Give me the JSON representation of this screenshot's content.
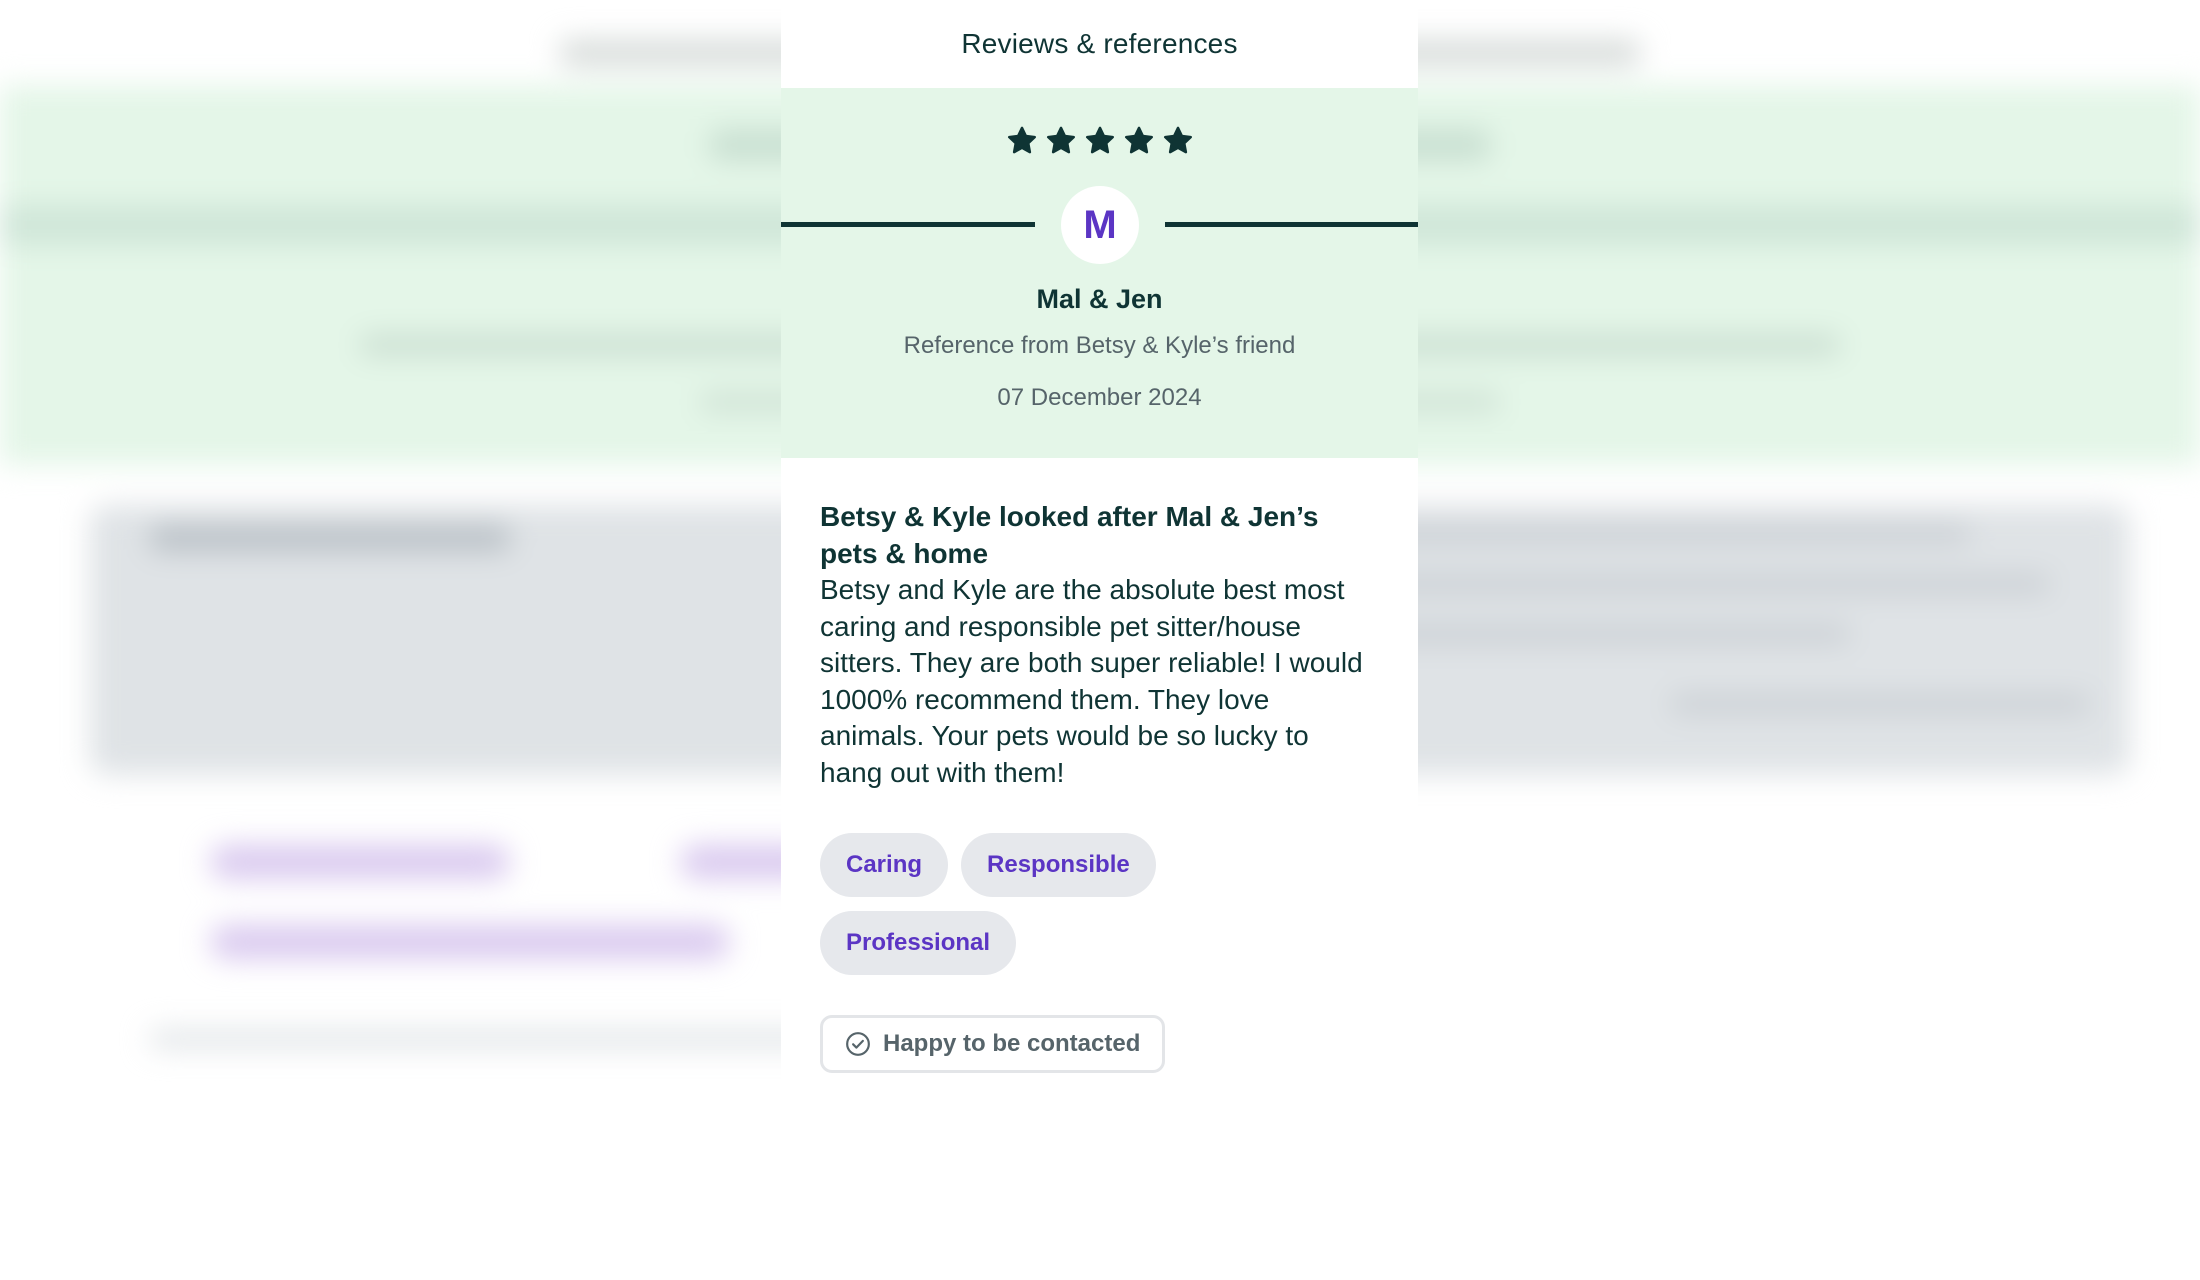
{
  "modal": {
    "title": "Reviews & references"
  },
  "review": {
    "rating": 5,
    "max_rating": 5,
    "avatar_initial": "M",
    "reviewer_name": "Mal & Jen",
    "reference_line": "Reference from Betsy & Kyle’s friend",
    "date": "07 December 2024",
    "title": "Betsy & Kyle looked after Mal & Jen’s pets & home",
    "text": "Betsy and Kyle are the absolute best most caring and responsible pet sitter/house sitters. They are both super reliable! I would 1000% recommend them. They love animals. Your pets would be so lucky to hang out with them!",
    "tags": [
      "Caring",
      "Responsible",
      "Professional"
    ],
    "contact_label": "Happy to be contacted"
  },
  "icons": {
    "star": "star-icon",
    "contact": "check-circle-icon"
  },
  "colors": {
    "hero_background": "#e4f6e8",
    "primary_text": "#0f3434",
    "accent_purple": "#5b35c4",
    "muted_text": "#56646a",
    "tag_background": "#e6e8ec"
  }
}
